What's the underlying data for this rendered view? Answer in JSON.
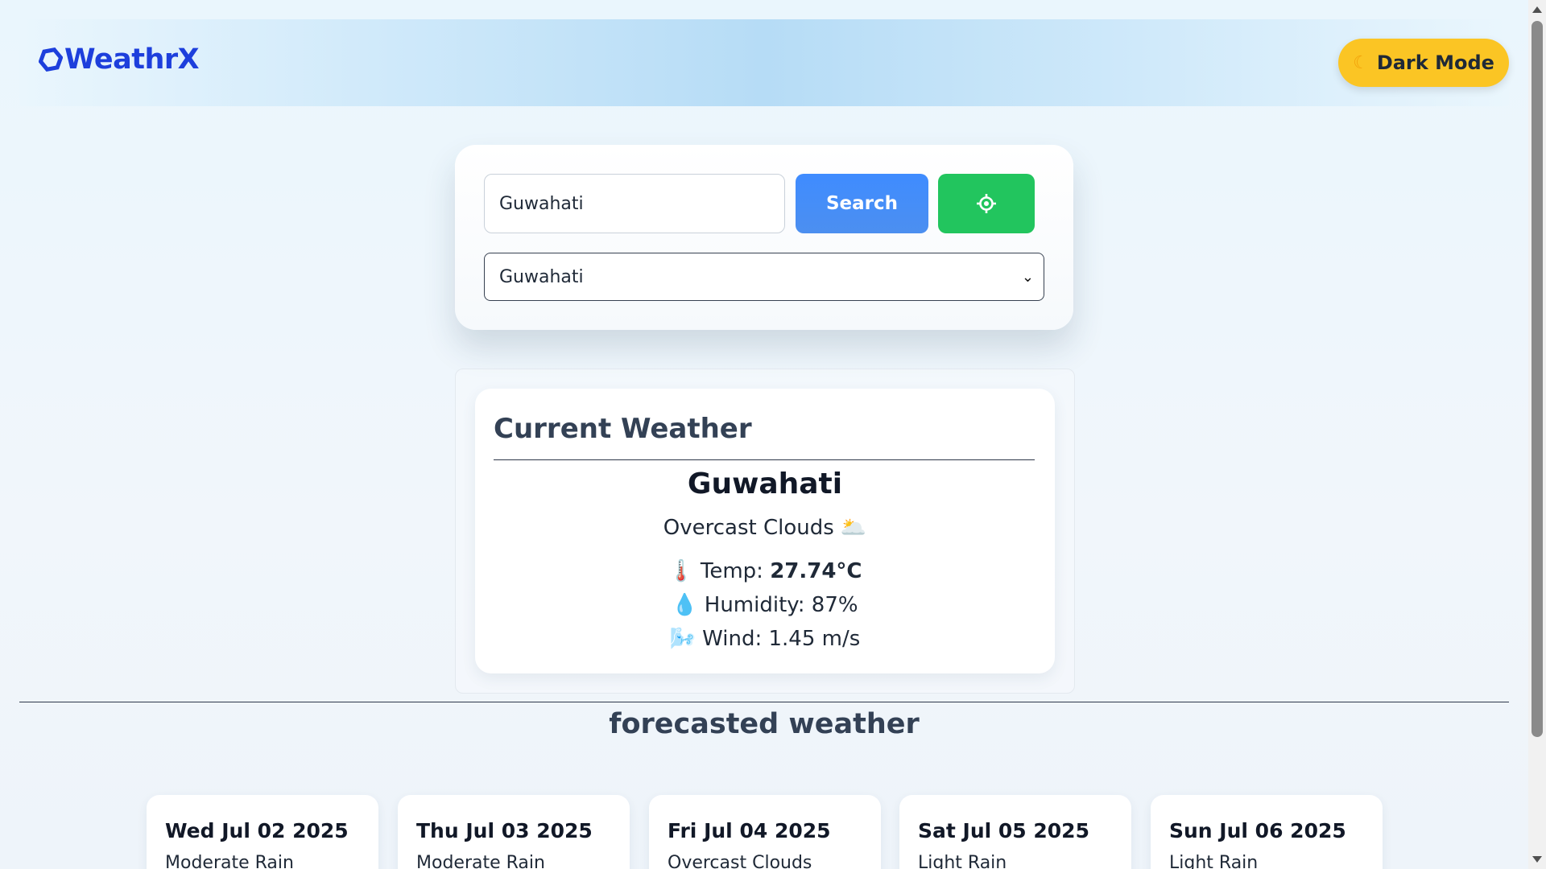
{
  "header": {
    "logo_text": "WeathrX",
    "logo_icon": "hexagon-logo-icon",
    "dark_mode_label": "Dark Mode",
    "dark_mode_icon": "moon-icon"
  },
  "search": {
    "input_value": "Guwahati",
    "search_button_label": "Search",
    "location_icon": "crosshair-location-icon",
    "select_value": "Guwahati"
  },
  "current": {
    "title": "Current Weather",
    "city": "Guwahati",
    "description": "Overcast Clouds",
    "description_icon": "sun-behind-cloud-icon",
    "temp_label": "Temp:",
    "temp_value": "27.74°C",
    "humidity_text": "Humidity: 87%",
    "wind_text": "Wind: 1.45 m/s"
  },
  "forecast": {
    "title": "forecasted weather",
    "days": [
      {
        "date": "Wed Jul 02 2025",
        "desc": "Moderate Rain"
      },
      {
        "date": "Thu Jul 03 2025",
        "desc": "Moderate Rain"
      },
      {
        "date": "Fri Jul 04 2025",
        "desc": "Overcast Clouds"
      },
      {
        "date": "Sat Jul 05 2025",
        "desc": "Light Rain"
      },
      {
        "date": "Sun Jul 06 2025",
        "desc": "Light Rain"
      }
    ]
  },
  "colors": {
    "brand": "#1d3fdc",
    "dark_mode_button": "#fbc524",
    "search_button": "#3f8cff",
    "location_button": "#22c55e"
  }
}
